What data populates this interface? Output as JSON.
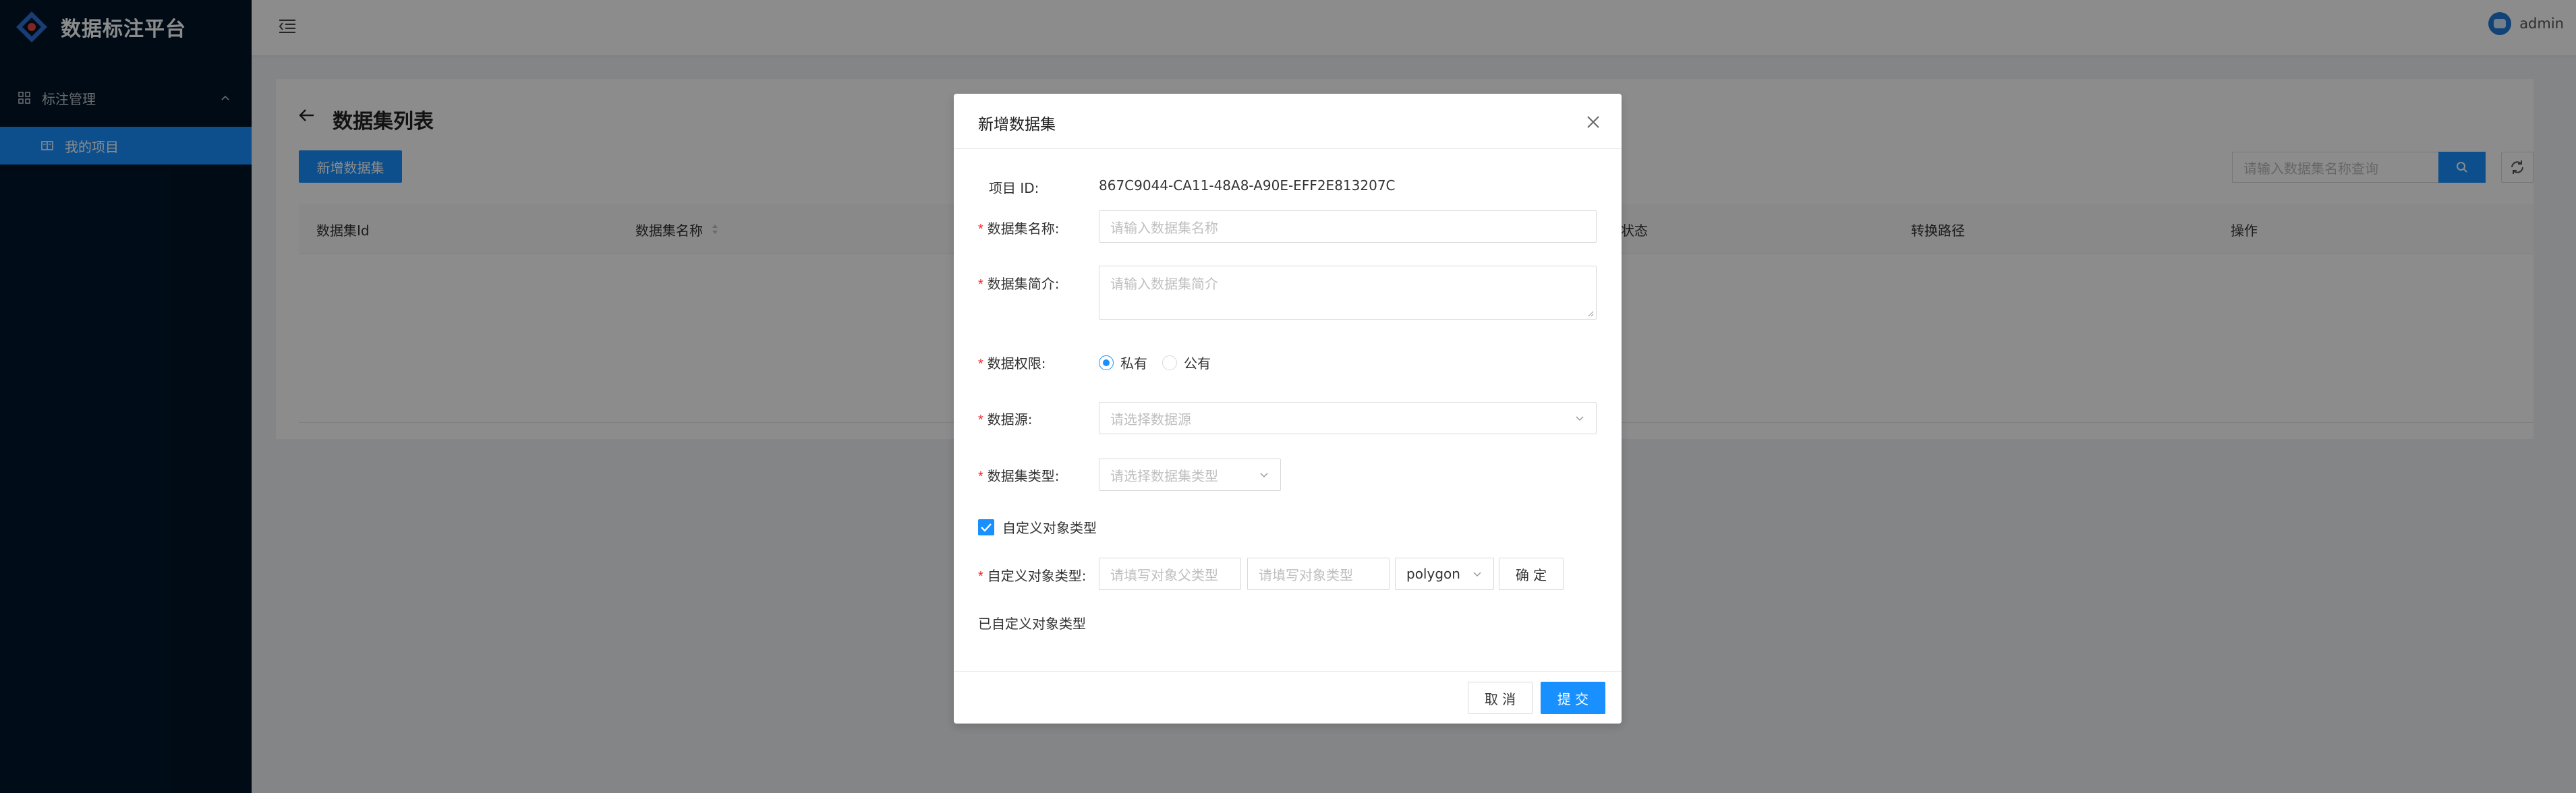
{
  "app": {
    "title": "数据标注平台"
  },
  "sidebar": {
    "group_label": "标注管理",
    "active_item_label": "我的项目"
  },
  "header": {
    "username": "admin"
  },
  "page": {
    "title": "数据集列表",
    "new_button": "新增数据集",
    "search_placeholder": "请输入数据集名称查询",
    "table_columns": [
      "数据集Id",
      "数据集名称",
      "状态",
      "转换路径",
      "操作"
    ]
  },
  "modal": {
    "title": "新增数据集",
    "project_id_label": "项目 ID:",
    "project_id_value": "867C9044-CA11-48A8-A90E-EFF2E813207C",
    "name_label": "数据集名称:",
    "name_placeholder": "请输入数据集名称",
    "desc_label": "数据集简介:",
    "desc_placeholder": "请输入数据集简介",
    "permission_label": "数据权限:",
    "permission_options": [
      "私有",
      "公有"
    ],
    "permission_selected": "私有",
    "source_label": "数据源:",
    "source_placeholder": "请选择数据源",
    "type_label": "数据集类型:",
    "type_placeholder": "请选择数据集类型",
    "custom_checkbox_label": "自定义对象类型",
    "custom_checkbox_checked": true,
    "custom_type_label": "自定义对象类型:",
    "parent_type_placeholder": "请填写对象父类型",
    "object_type_placeholder": "请填写对象类型",
    "shape_value": "polygon",
    "confirm_button": "确 定",
    "defined_types_label": "已自定义对象类型",
    "cancel_button": "取 消",
    "submit_button": "提 交"
  },
  "colors": {
    "primary": "#1890ff",
    "sidebar_bg": "#001529",
    "required": "#f5222d"
  }
}
